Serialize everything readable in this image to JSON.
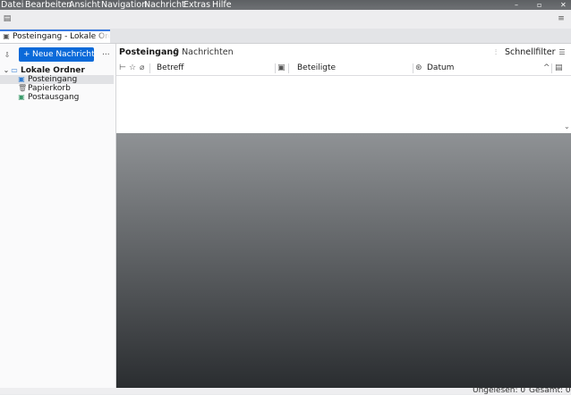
{
  "menubar": {
    "items": [
      "Datei",
      "Bearbeiten",
      "Ansicht",
      "Navigation",
      "Nachricht",
      "Extras",
      "Hilfe"
    ]
  },
  "tab": {
    "label": "Posteingang - Lokale Ordner"
  },
  "folderpane": {
    "new_message_label": "Neue Nachricht",
    "more_label": "...",
    "root": "Lokale Ordner",
    "folders": [
      "Posteingang",
      "Papierkorb",
      "Postausgang"
    ]
  },
  "threadpane": {
    "folder_name": "Posteingang",
    "message_count": "0 Nachrichten",
    "quickfilter_label": "Schnellfilter",
    "columns": {
      "subject": "Betreff",
      "participants": "Beteiligte",
      "date": "Datum"
    }
  },
  "statusbar": {
    "unread": "Ungelesen: 0",
    "total": "Gesamt: 0"
  },
  "colors": {
    "accent": "#0b6ad9",
    "tab_border": "#3a7be0",
    "menubar": "#5d6063"
  }
}
